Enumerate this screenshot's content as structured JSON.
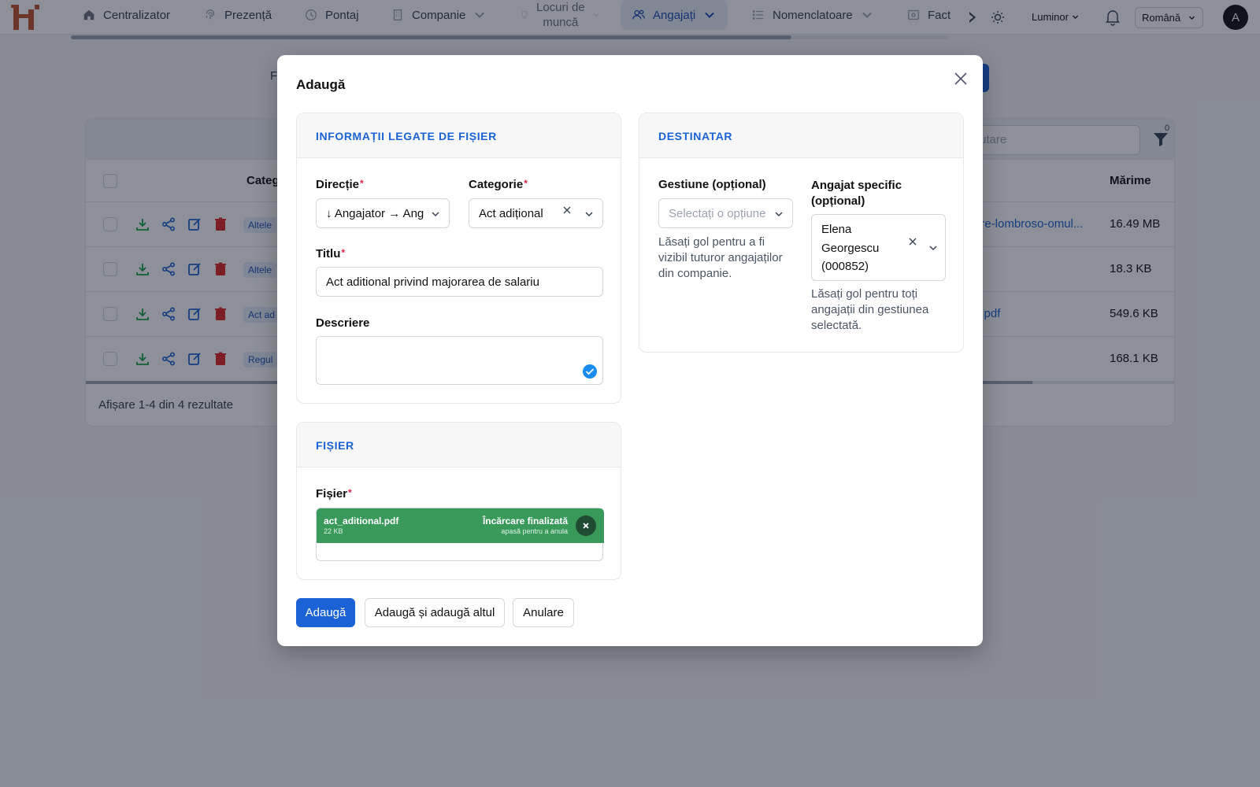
{
  "nav": {
    "items": [
      {
        "label": "Centralizator",
        "icon": "home-icon"
      },
      {
        "label": "Prezență",
        "icon": "fingerprint-icon"
      },
      {
        "label": "Pontaj",
        "icon": "clock-icon"
      },
      {
        "label": "Companie",
        "icon": "building-icon"
      },
      {
        "label_line1": "Locuri de",
        "label_line2": "muncă",
        "icon": "map-pin-icon"
      },
      {
        "label": "Angajați",
        "icon": "users-icon",
        "active": true
      },
      {
        "label": "Nomenclatoare",
        "icon": "list-icon"
      },
      {
        "label": "Fact",
        "icon": "invoice-icon"
      }
    ],
    "theme_label": "Luminor",
    "language": "Română",
    "avatar_initial": "A"
  },
  "background_page": {
    "partial_label": "F",
    "search_placeholder": "utare",
    "filter_count": "0",
    "columns": {
      "category": "Categ",
      "size": "Mărime"
    },
    "rows": [
      {
        "category": "Altele",
        "file": "are-lombroso-omul...",
        "size": "16.49 MB"
      },
      {
        "category": "Altele",
        "file": "",
        "size": "18.3 KB"
      },
      {
        "category": "Act ad",
        "file": "a.pdf",
        "size": "549.6 KB"
      },
      {
        "category": "Regul",
        "file": "",
        "size": "168.1 KB"
      }
    ],
    "footer": "Afișare 1-4 din 4 rezultate"
  },
  "modal": {
    "title": "Adaugă",
    "file_info": {
      "heading": "INFORMAȚII LEGATE DE FIȘIER",
      "direction_label": "Direcție",
      "direction_value": "↓ Angajator → Ang",
      "category_label": "Categorie",
      "category_value": "Act adițional",
      "title_label": "Titlu",
      "title_value": "Act aditional privind majorarea de salariu",
      "description_label": "Descriere",
      "description_value": ""
    },
    "recipient": {
      "heading": "DESTINATAR",
      "gestiune_label": "Gestiune (opțional)",
      "gestiune_placeholder": "Selectați o opțiune",
      "gestiune_help": "Lăsați gol pentru a fi vizibil tuturor angajaților din companie.",
      "employee_label": "Angajat specific (opțional)",
      "employee_value": "Elena Georgescu (000852)",
      "employee_help": "Lăsați gol pentru toți angajații din gestiunea selectată."
    },
    "file": {
      "heading": "FIȘIER",
      "label": "Fișier",
      "name": "act_aditional.pdf",
      "size": "22 KB",
      "status": "Încărcare finalizată",
      "hint": "apasă pentru a anula"
    },
    "buttons": {
      "submit": "Adaugă",
      "submit_another": "Adaugă și adaugă altul",
      "cancel": "Anulare"
    },
    "required_mark": "*"
  }
}
